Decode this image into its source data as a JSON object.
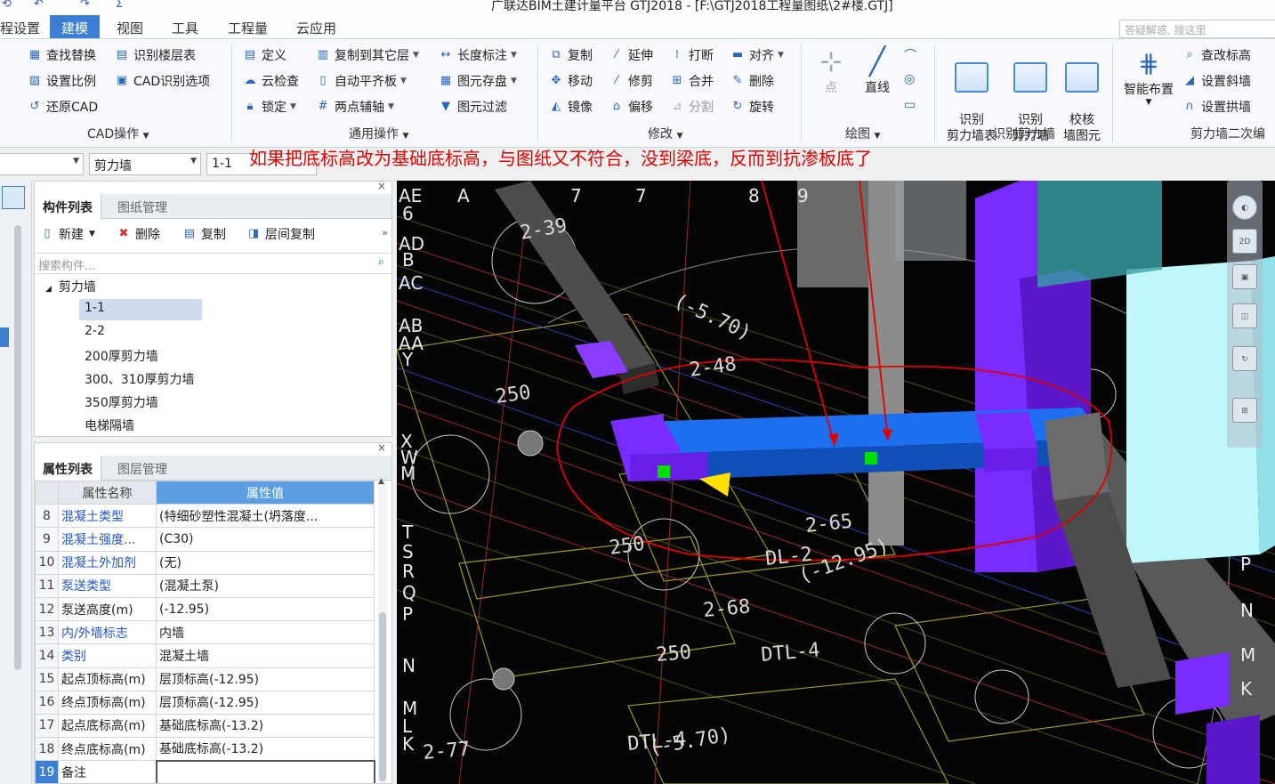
{
  "titlebar": {
    "title": "广联达BIM土建计量平台 GTJ2018 - [F:\\GTJ2018工程量图纸\\2#楼.GTJ]"
  },
  "tabs": [
    "程设置",
    "建模",
    "视图",
    "工具",
    "工程量",
    "云应用"
  ],
  "search_placeholder": "答疑解惑, 搜这里",
  "ribbon": {
    "cad": {
      "items": [
        "查找替换",
        "识别楼层表",
        "设置比例",
        "CAD识别选项",
        "还原CAD"
      ],
      "label": "CAD操作"
    },
    "general": {
      "items": [
        "定义",
        "复制到其它层",
        "长度标注",
        "云检查",
        "自动平齐板",
        "图元存盘",
        "锁定",
        "两点辅轴",
        "图元过滤"
      ],
      "label": "通用操作"
    },
    "modify": {
      "items": [
        "复制",
        "延伸",
        "打断",
        "对齐",
        "移动",
        "修剪",
        "合并",
        "删除",
        "镜像",
        "偏移",
        "分割",
        "旋转"
      ],
      "label": "修改"
    },
    "draw": {
      "items": [
        "点",
        "直线"
      ],
      "label": "绘图"
    },
    "recognize": {
      "items": [
        "识别\n剪力墙表",
        "识别\n剪力墙",
        "校核\n墙图元"
      ],
      "label": "识别剪力墙"
    },
    "secondary": {
      "smart": "智能布置",
      "items": [
        "查改标高",
        "设置斜墙",
        "设置拱墙"
      ],
      "label": "剪力墙二次编"
    }
  },
  "selectors": {
    "category": "剪力墙",
    "instance": "1-1"
  },
  "component_panel": {
    "tabs": [
      "构件列表",
      "图纸管理"
    ],
    "toolbar": [
      "新建",
      "删除",
      "复制",
      "层间复制"
    ],
    "search_placeholder": "搜索构件...",
    "tree_root": "剪力墙",
    "items": [
      "1-1",
      "2-2",
      "200厚剪力墙",
      "300、310厚剪力墙",
      "350厚剪力墙",
      "电梯隔墙"
    ]
  },
  "property_panel": {
    "tabs": [
      "属性列表",
      "图层管理"
    ],
    "headers": [
      "属性名称",
      "属性值"
    ],
    "rows": [
      {
        "num": "8",
        "name": "混凝土类型",
        "value": "(特细砂塑性混凝土(坍落度...",
        "link": true
      },
      {
        "num": "9",
        "name": "混凝土强度...",
        "value": "(C30)",
        "link": true
      },
      {
        "num": "10",
        "name": "混凝土外加剂",
        "value": "(无)",
        "link": true
      },
      {
        "num": "11",
        "name": "泵送类型",
        "value": "(混凝土泵)",
        "link": true
      },
      {
        "num": "12",
        "name": "泵送高度(m)",
        "value": "(-12.95)",
        "link": false
      },
      {
        "num": "13",
        "name": "内/外墙标志",
        "value": "内墙",
        "link": true
      },
      {
        "num": "14",
        "name": "类别",
        "value": "混凝土墙",
        "link": true
      },
      {
        "num": "15",
        "name": "起点顶标高(m)",
        "value": "层顶标高(-12.95)",
        "link": false
      },
      {
        "num": "16",
        "name": "终点顶标高(m)",
        "value": "层顶标高(-12.95)",
        "link": false
      },
      {
        "num": "17",
        "name": "起点底标高(m)",
        "value": "基础底标高(-13.2)",
        "link": false
      },
      {
        "num": "18",
        "name": "终点底标高(m)",
        "value": "基础底标高(-13.2)",
        "link": false
      },
      {
        "num": "19",
        "name": "备注",
        "value": "",
        "link": false
      }
    ]
  },
  "annotation": "如果把底标高改为基础底标高，与图纸又不符合，没到梁底，反而到抗渗板底了",
  "cad_labels": {
    "axis_left": [
      "AE",
      "6",
      "AD",
      "B",
      "AC",
      "AB",
      "AA",
      "Y",
      "X",
      "W",
      "M",
      "T",
      "S",
      "R",
      "Q",
      "P",
      "N",
      "M",
      "L",
      "K"
    ],
    "axis_top": [
      "A",
      "7",
      "7",
      "8",
      "9"
    ],
    "axis_right": [
      "P",
      "N",
      "M",
      "K"
    ],
    "texts": [
      "2-39",
      "2-48",
      "2-65",
      "2-68",
      "2-77",
      "250",
      "250",
      "250",
      "DL-2",
      "DTL-4",
      "DTL-4",
      "(-12.95)",
      "(-5.70)",
      "(-5.70)"
    ]
  },
  "colors": {
    "accent": "#3c7fd2",
    "annotation_red": "#e00000",
    "wall_purple": "#7a2cff",
    "wall_blue": "#1e6ff0",
    "beam_gray": "#5f5f5f",
    "highlight_cyan": "#bff7fb"
  }
}
